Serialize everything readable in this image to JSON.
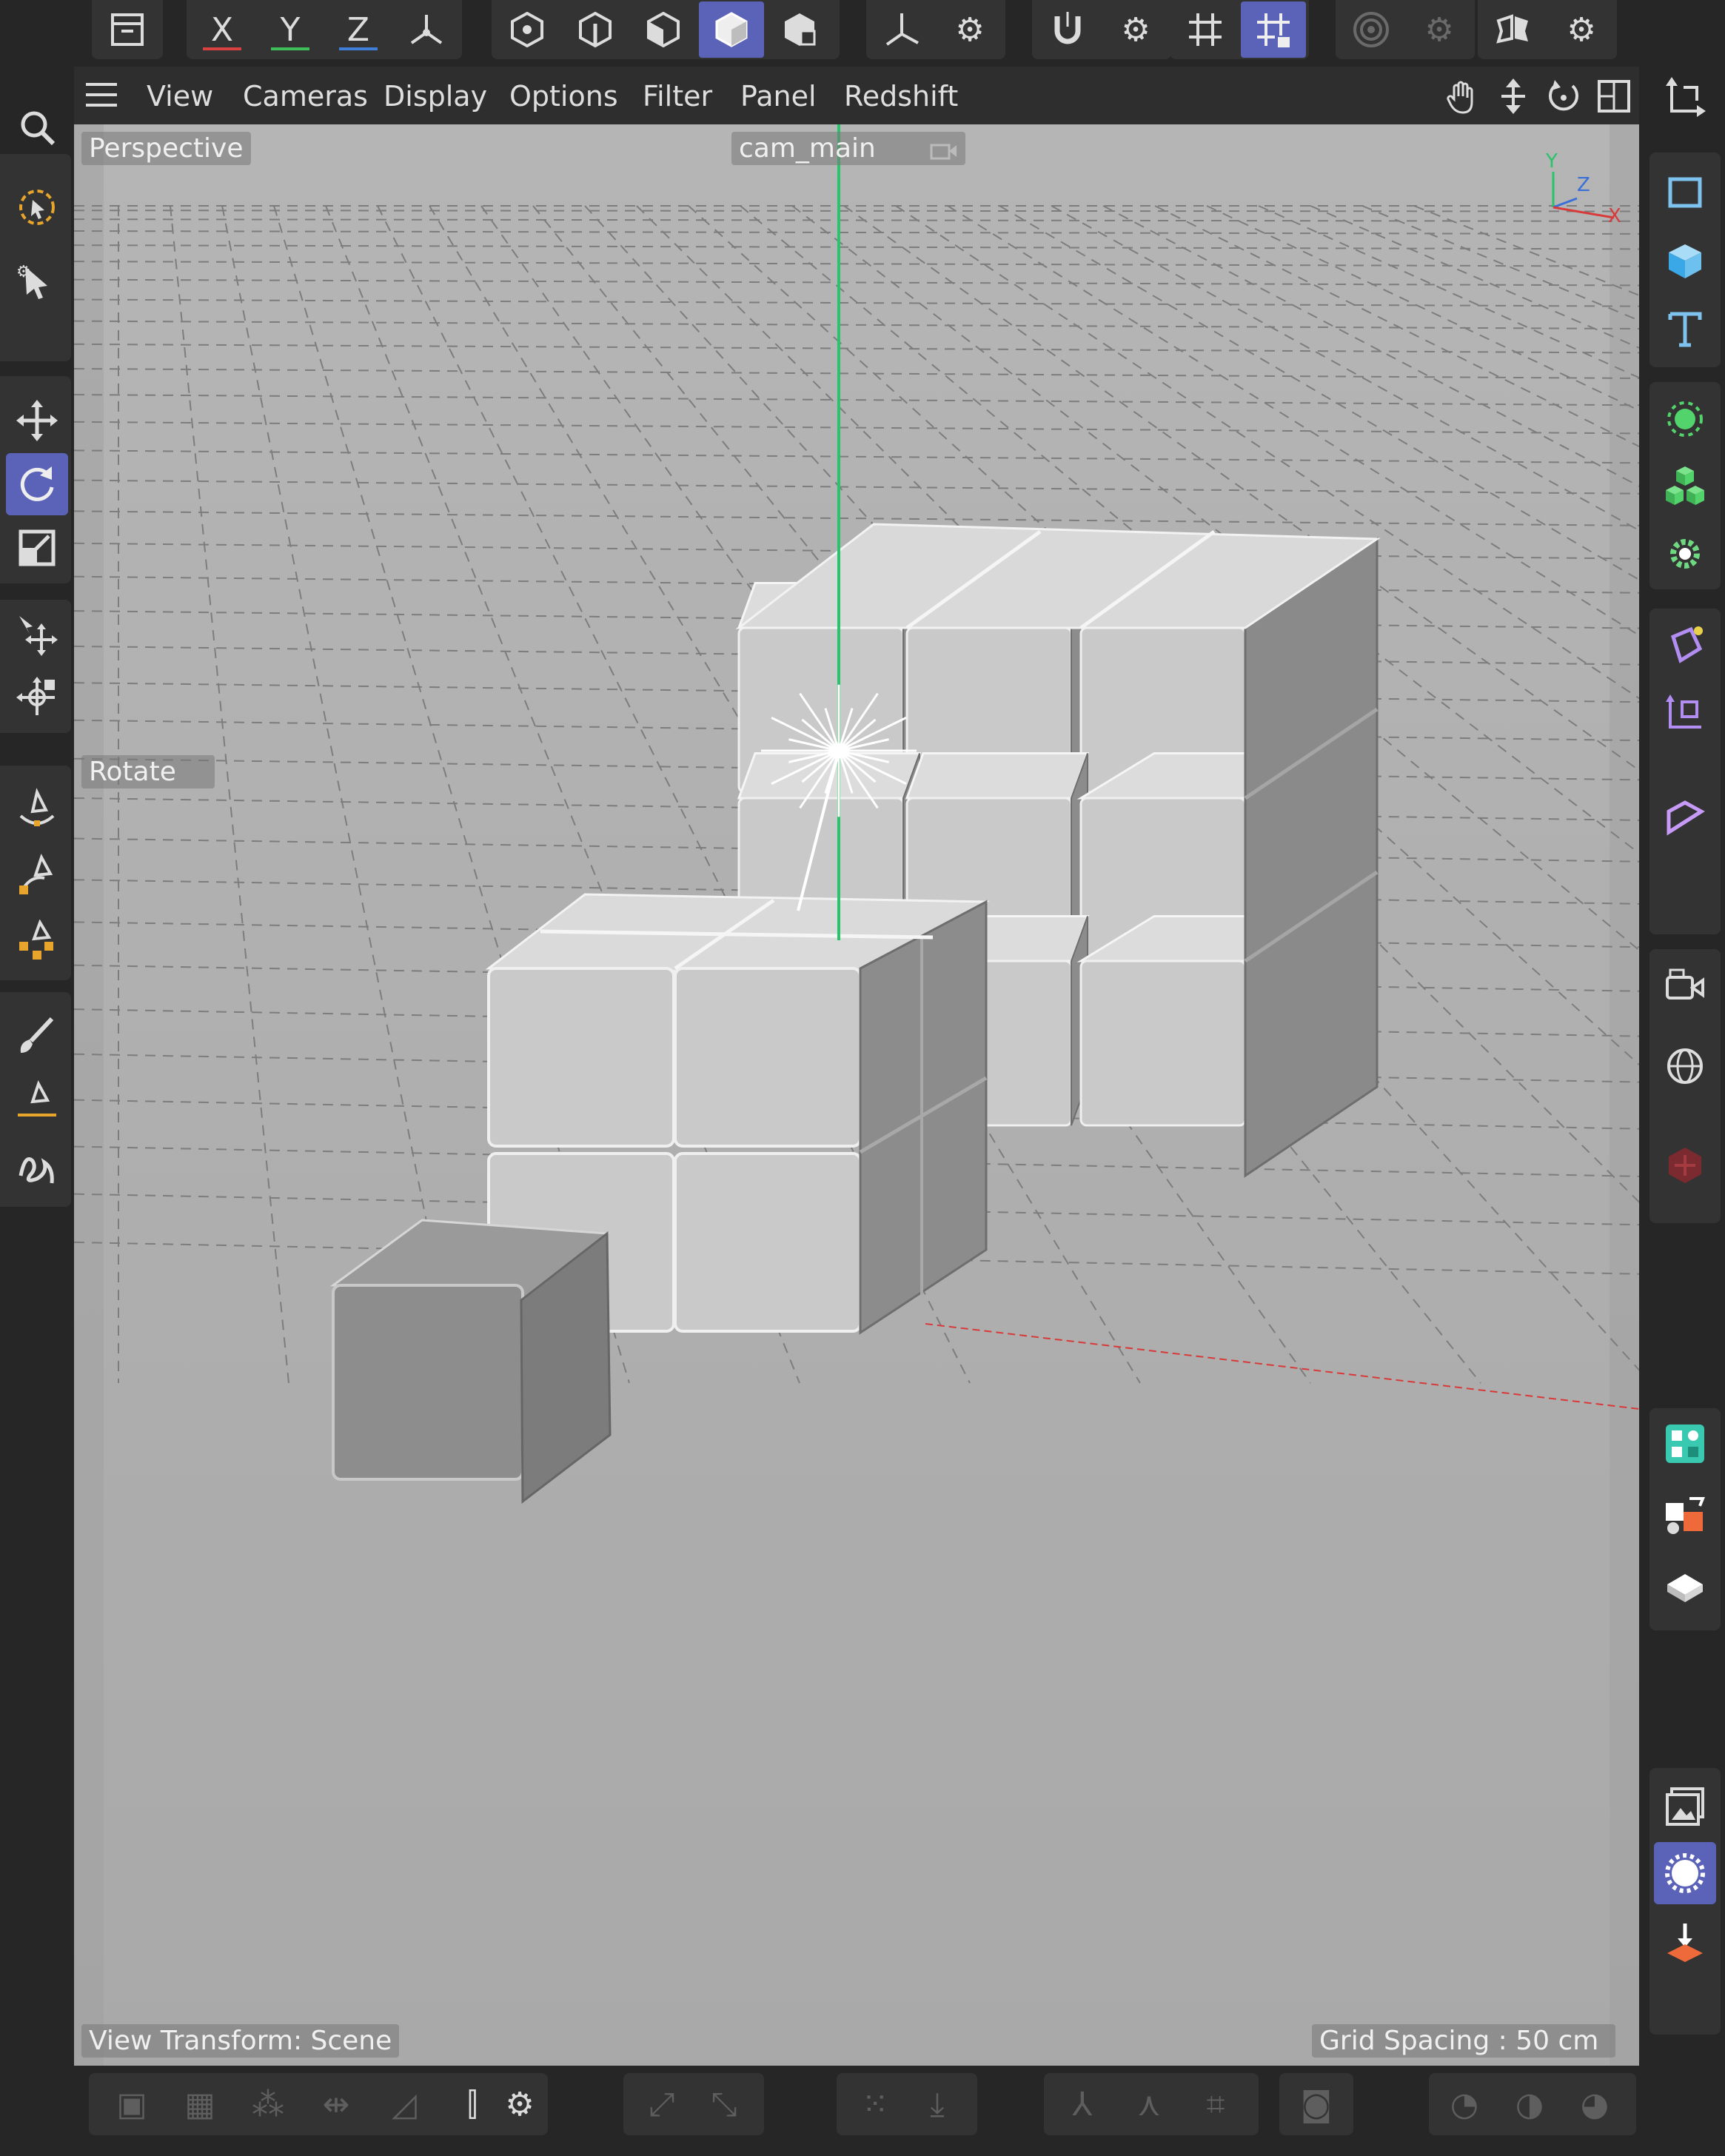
{
  "top_toolbar": {
    "axis_x": "X",
    "axis_y": "Y",
    "axis_z": "Z",
    "icons": [
      "model-mode-icon",
      "axis-x-lock",
      "axis-y-lock",
      "axis-z-lock",
      "coordinate-system-icon",
      "points-mode-icon",
      "edges-mode-icon",
      "polygons-mode-icon",
      "object-mode-icon",
      "texture-mode-icon",
      "axis-tool-icon",
      "settings-gear-icon",
      "snap-magnet-icon",
      "settings-gear-icon",
      "workplane-grid-icon",
      "locked-workplane-icon",
      "soft-selection-icon",
      "settings-gear-icon",
      "symmetry-icon",
      "settings-gear-icon"
    ]
  },
  "menu": {
    "items": [
      "View",
      "Cameras",
      "Display",
      "Options",
      "Filter",
      "Panel",
      "Redshift"
    ],
    "nav_icons": [
      "pan-hand-icon",
      "dolly-icon",
      "orbit-icon",
      "maximize-view-icon"
    ]
  },
  "viewport": {
    "view_name": "Perspective",
    "camera_name": "cam_main",
    "tool_label": "Rotate",
    "view_transform": "View Transform: Scene",
    "grid_spacing": "Grid Spacing : 50 cm",
    "axis_widget": {
      "y": "Y",
      "z": "Z",
      "x": "X"
    },
    "colors": {
      "background": "#adadad",
      "y_axis": "#27c46a",
      "x_axis": "#d83a3a",
      "cube_top": "#dcdcdc",
      "cube_front": "#c9c9c9",
      "cube_side": "#8c8c8c"
    }
  },
  "left_toolbar": {
    "icons": [
      "search-icon",
      "live-selection-icon",
      "selection-tool-icon",
      "move-icon",
      "rotate-icon",
      "scale-icon",
      "move-transform-icon",
      "transform-all-icon",
      "spline-pen-icon",
      "spline-points-icon",
      "spline-edit-icon",
      "brush-icon",
      "spline-cut-icon",
      "sketch-icon"
    ],
    "active": "rotate-icon"
  },
  "right_toolbar": {
    "icons": [
      "coordinates-icon",
      "rectangle-spline-icon",
      "cube-primitive-icon",
      "text-spline-icon",
      "generator-icon",
      "cloner-icon",
      "deformer-gear-icon",
      "field-icon",
      "volume-icon",
      "effector-icon",
      "camera-icon",
      "sky-globe-icon",
      "redshift-object-icon",
      "modules-icon",
      "asset-browser-icon",
      "floor-icon",
      "picture-viewer-icon",
      "render-settings-icon",
      "render-to-po-icon"
    ],
    "active": "render-settings-icon"
  },
  "bottom_toolbar": {
    "icons": [
      "enable-snap-icon",
      "snap-points-icon",
      "snap-grid-icon",
      "snap-edge-icon",
      "snap-polygon-icon",
      "quantize-icon",
      "settings-gear-icon",
      "axis-snap-icon",
      "snap-down-icon",
      "pivot-icon",
      "align-icon",
      "bone-icon",
      "joint-icon",
      "mask-icon",
      "shading-icon",
      "display-icon",
      "render-icon",
      "material-icon"
    ]
  }
}
